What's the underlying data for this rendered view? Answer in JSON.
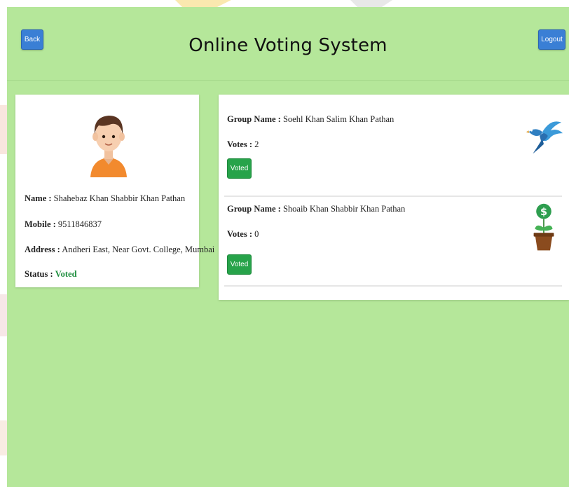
{
  "header": {
    "back_label": "Back",
    "title": "Online Voting System",
    "logout_label": "Logout"
  },
  "profile": {
    "name_label": "Name :",
    "name_value": "Shahebaz Khan Shabbir Khan Pathan",
    "mobile_label": "Mobile :",
    "mobile_value": "9511846837",
    "address_label": "Address :",
    "address_value": "Andheri East, Near Govt. College, Mumbai",
    "status_label": "Status :",
    "status_value": "Voted"
  },
  "groups": [
    {
      "name_label": "Group Name :",
      "name_value": "Soehl Khan Salim Khan Pathan",
      "votes_label": "Votes :",
      "votes_value": "2",
      "button_label": "Voted",
      "symbol": "bird-icon"
    },
    {
      "name_label": "Group Name :",
      "name_value": "Shoaib Khan Shabbir Khan Pathan",
      "votes_label": "Votes :",
      "votes_value": "0",
      "button_label": "Voted",
      "symbol": "money-plant-icon"
    }
  ],
  "colors": {
    "app_background": "#b5e79a",
    "primary_button": "#3a7fd5",
    "voted_button": "#27a34a",
    "voted_status": "#1e8e3e"
  }
}
